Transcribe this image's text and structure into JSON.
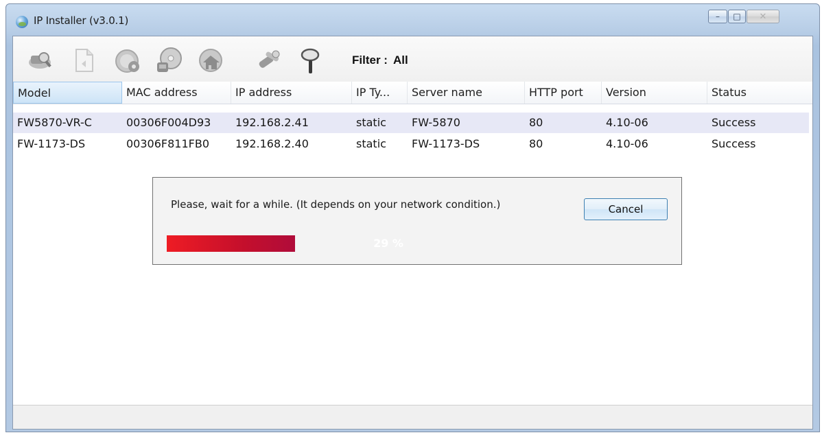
{
  "window": {
    "title": "IP Installer (v3.0.1)",
    "icon": "globe-icon",
    "controls": {
      "minimize": "–",
      "maximize": "□",
      "close": "✕"
    }
  },
  "toolbar": {
    "buttons": [
      {
        "name": "search-devices-button",
        "icon": "search-network-icon"
      },
      {
        "name": "document-button",
        "icon": "document-icon"
      },
      {
        "name": "settings-button",
        "icon": "network-settings-icon"
      },
      {
        "name": "upgrade-button",
        "icon": "disc-upgrade-icon"
      },
      {
        "name": "home-button",
        "icon": "home-network-icon"
      },
      {
        "name": "tools-button",
        "icon": "tools-icon"
      },
      {
        "name": "filter-button",
        "icon": "magnifier-icon"
      }
    ],
    "filter_label": "Filter :",
    "filter_value": "All"
  },
  "table": {
    "columns": [
      "Model",
      "MAC address",
      "IP address",
      "IP Ty...",
      "Server name",
      "HTTP port",
      "Version",
      "Status"
    ],
    "rows": [
      [
        "FW5870-VR-C",
        "00306F004D93",
        "192.168.2.41",
        "static",
        "FW-5870",
        "80",
        "4.10-06",
        "Success"
      ],
      [
        "FW-1173-DS",
        "00306F811FB0",
        "192.168.2.40",
        "static",
        "FW-1173-DS",
        "80",
        "4.10-06",
        "Success"
      ]
    ]
  },
  "dialog": {
    "message": "Please, wait for a while. (It depends on your network condition.)",
    "cancel_label": "Cancel",
    "progress_percent": 29,
    "progress_text": "29 %"
  },
  "colors": {
    "progress_start": "#ee1c24",
    "progress_end": "#b00c3a",
    "selected_row": "#e7e8f6"
  }
}
